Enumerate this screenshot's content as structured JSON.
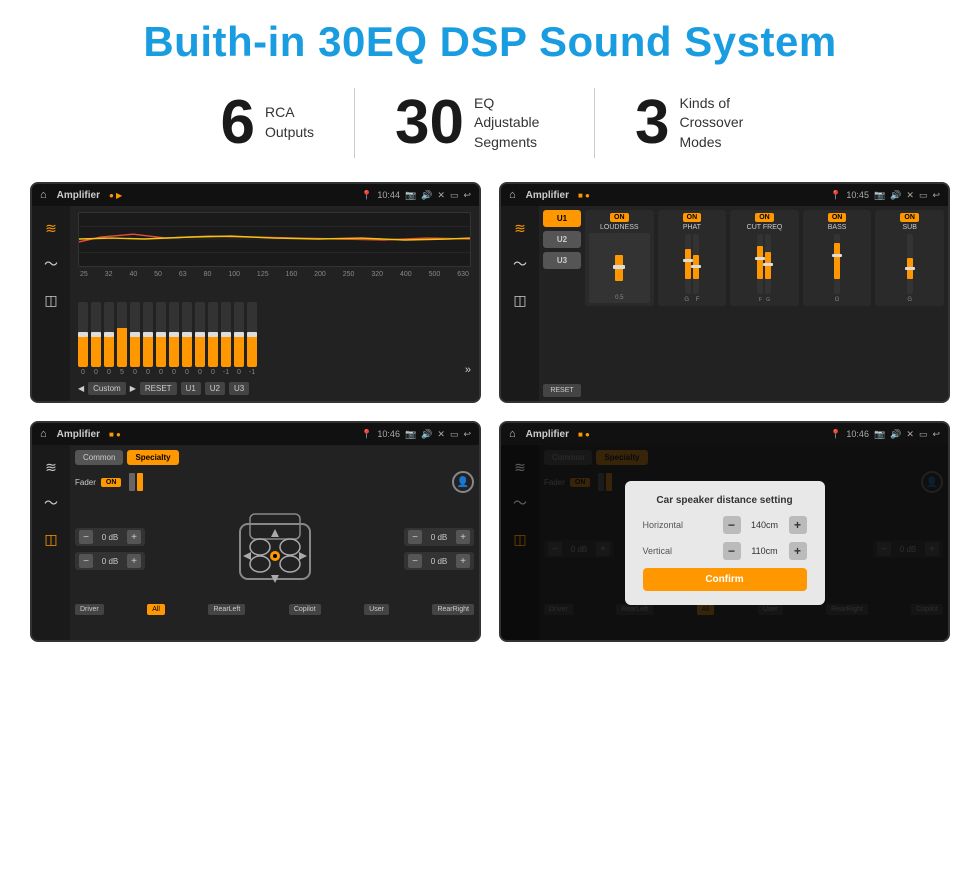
{
  "title": "Buith-in 30EQ DSP Sound System",
  "stats": [
    {
      "number": "6",
      "label": "RCA\nOutputs"
    },
    {
      "number": "30",
      "label": "EQ Adjustable\nSegments"
    },
    {
      "number": "3",
      "label": "Kinds of\nCrossover Modes"
    }
  ],
  "screens": [
    {
      "id": "eq-screen",
      "statusBar": {
        "title": "Amplifier",
        "time": "10:44",
        "icons": [
          "camera",
          "volume",
          "x",
          "battery",
          "back"
        ]
      },
      "type": "eq",
      "freqLabels": [
        "25",
        "32",
        "40",
        "50",
        "63",
        "80",
        "100",
        "125",
        "160",
        "200",
        "250",
        "320",
        "400",
        "500",
        "630"
      ],
      "sliderValues": [
        "0",
        "0",
        "0",
        "5",
        "0",
        "0",
        "0",
        "0",
        "0",
        "0",
        "0",
        "-1",
        "0",
        "-1"
      ],
      "bottomButtons": [
        "Custom",
        "RESET",
        "U1",
        "U2",
        "U3"
      ]
    },
    {
      "id": "crossover-screen",
      "statusBar": {
        "title": "Amplifier",
        "time": "10:45",
        "icons": [
          "camera",
          "volume",
          "x",
          "battery",
          "back"
        ]
      },
      "type": "crossover",
      "uButtons": [
        "U1",
        "U2",
        "U3"
      ],
      "channels": [
        "LOUDNESS",
        "PHAT",
        "CUT FREQ",
        "BASS",
        "SUB"
      ],
      "resetBtn": "RESET"
    },
    {
      "id": "speaker-screen",
      "statusBar": {
        "title": "Amplifier",
        "time": "10:46",
        "icons": [
          "camera",
          "volume",
          "x",
          "battery",
          "back"
        ]
      },
      "type": "speaker",
      "tabs": [
        "Common",
        "Specialty"
      ],
      "faderLabel": "Fader",
      "faderOn": "ON",
      "dbValues": [
        "0 dB",
        "0 dB",
        "0 dB",
        "0 dB"
      ],
      "positions": [
        "Driver",
        "All",
        "RearLeft",
        "User",
        "RearRight"
      ],
      "copilot": "Copilot"
    },
    {
      "id": "dialog-screen",
      "statusBar": {
        "title": "Amplifier",
        "time": "10:46",
        "icons": [
          "camera",
          "volume",
          "x",
          "battery",
          "back"
        ]
      },
      "type": "dialog",
      "tabs": [
        "Common",
        "Specialty"
      ],
      "dialog": {
        "title": "Car speaker distance setting",
        "horizontal": {
          "label": "Horizontal",
          "value": "140cm"
        },
        "vertical": {
          "label": "Vertical",
          "value": "110cm"
        },
        "confirmBtn": "Confirm"
      },
      "dbValues": [
        "0 dB",
        "0 dB"
      ],
      "positions": [
        "Driver",
        "RearLeft",
        "All",
        "User",
        "RearRight",
        "Copilot"
      ]
    }
  ]
}
